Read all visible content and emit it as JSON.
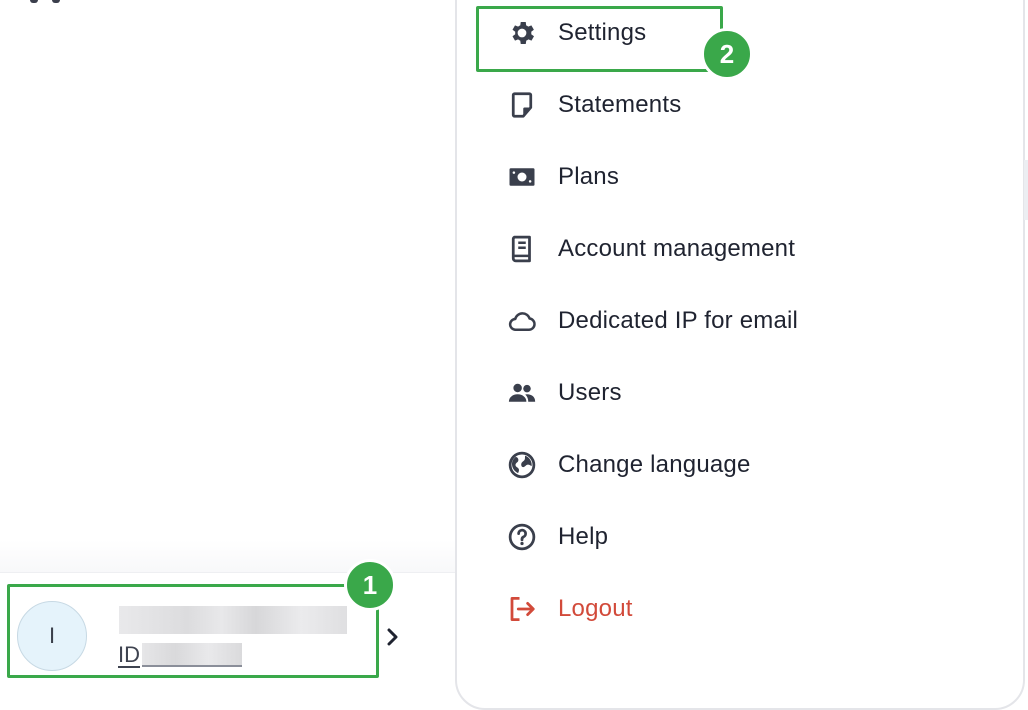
{
  "colors": {
    "accent_green": "#3aa84a",
    "logout_red": "#d24a3a",
    "text": "#1f2330"
  },
  "account": {
    "avatar_initial": "I",
    "id_label": "ID"
  },
  "badges": {
    "one": "1",
    "two": "2"
  },
  "menu": {
    "items": [
      {
        "label": "Settings",
        "icon": "gear-icon"
      },
      {
        "label": "Statements",
        "icon": "document-icon"
      },
      {
        "label": "Plans",
        "icon": "money-icon"
      },
      {
        "label": "Account management",
        "icon": "book-icon"
      },
      {
        "label": "Dedicated IP for email",
        "icon": "cloud-icon"
      },
      {
        "label": "Users",
        "icon": "users-icon"
      },
      {
        "label": "Change language",
        "icon": "globe-icon"
      },
      {
        "label": "Help",
        "icon": "help-icon"
      },
      {
        "label": "Logout",
        "icon": "logout-icon"
      }
    ]
  }
}
